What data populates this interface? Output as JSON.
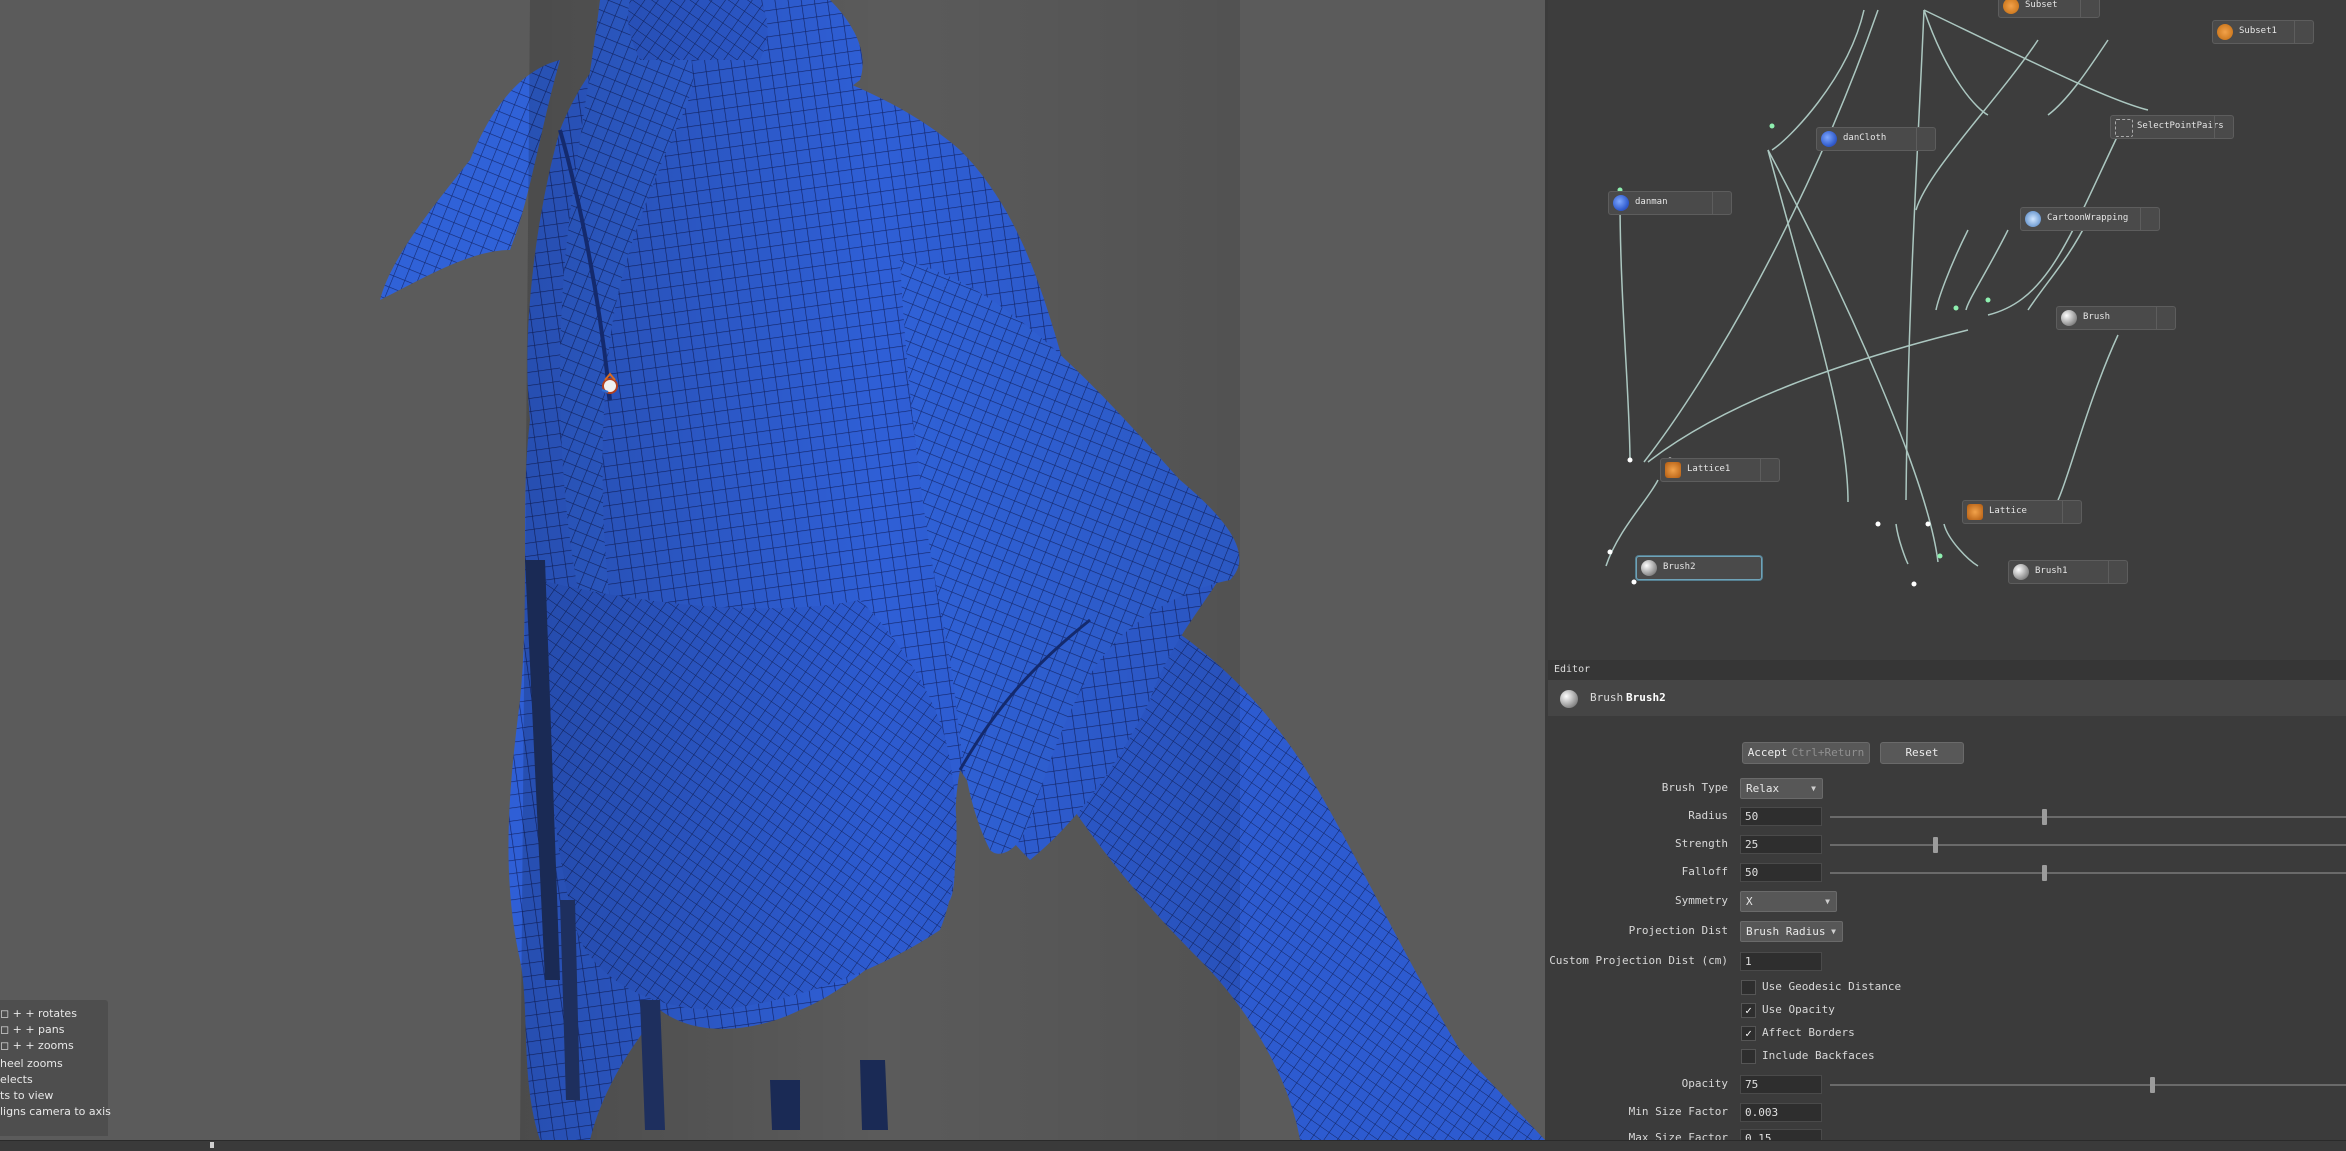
{
  "viewport": {
    "hints": [
      "+ rotates",
      "+ pans",
      "+ zooms",
      "heel zooms",
      "elects",
      "ts to view",
      "ligns camera to axis"
    ]
  },
  "graph": {
    "nodes": {
      "subset": "Subset",
      "subset1": "Subset1",
      "dancloth": "danCloth",
      "select_point_pairs": "SelectPointPairs",
      "danman": "danman",
      "cartoon_wrapping": "CartoonWrapping",
      "brush": "Brush",
      "lattice1": "Lattice1",
      "lattice": "Lattice",
      "brush2": "Brush2",
      "brush1": "Brush1"
    }
  },
  "editor": {
    "title": "Editor",
    "node_type": "Brush",
    "node_name": "Brush2",
    "accept_label": "Accept",
    "accept_shortcut": "Ctrl+Return",
    "reset_label": "Reset",
    "params": {
      "brush_type": {
        "label": "Brush Type",
        "value": "Relax"
      },
      "radius": {
        "label": "Radius",
        "value": "50",
        "slider": 0.41
      },
      "strength": {
        "label": "Strength",
        "value": "25",
        "slider": 0.2
      },
      "falloff": {
        "label": "Falloff",
        "value": "50",
        "slider": 0.41
      },
      "symmetry": {
        "label": "Symmetry",
        "value": "X"
      },
      "projection_dist": {
        "label": "Projection Dist",
        "value": "Brush Radius"
      },
      "custom_projection": {
        "label": "Custom Projection Dist (cm)",
        "value": "1"
      },
      "use_geodesic": {
        "label": "Use Geodesic Distance",
        "checked": false
      },
      "use_opacity": {
        "label": "Use Opacity",
        "checked": true
      },
      "affect_borders": {
        "label": "Affect Borders",
        "checked": true
      },
      "include_backfaces": {
        "label": "Include Backfaces",
        "checked": false
      },
      "opacity": {
        "label": "Opacity",
        "value": "75",
        "slider": 0.62
      },
      "min_size_factor": {
        "label": "Min Size Factor",
        "value": "0.003"
      },
      "max_size_factor": {
        "label": "Max Size Factor",
        "value": "0.15"
      }
    }
  },
  "colors": {
    "mesh_blue": "#2f5fd6",
    "viewport_bg": "#5b5b5b",
    "graph_bg": "#3d3d3d",
    "wire": "#b8d6cf"
  }
}
